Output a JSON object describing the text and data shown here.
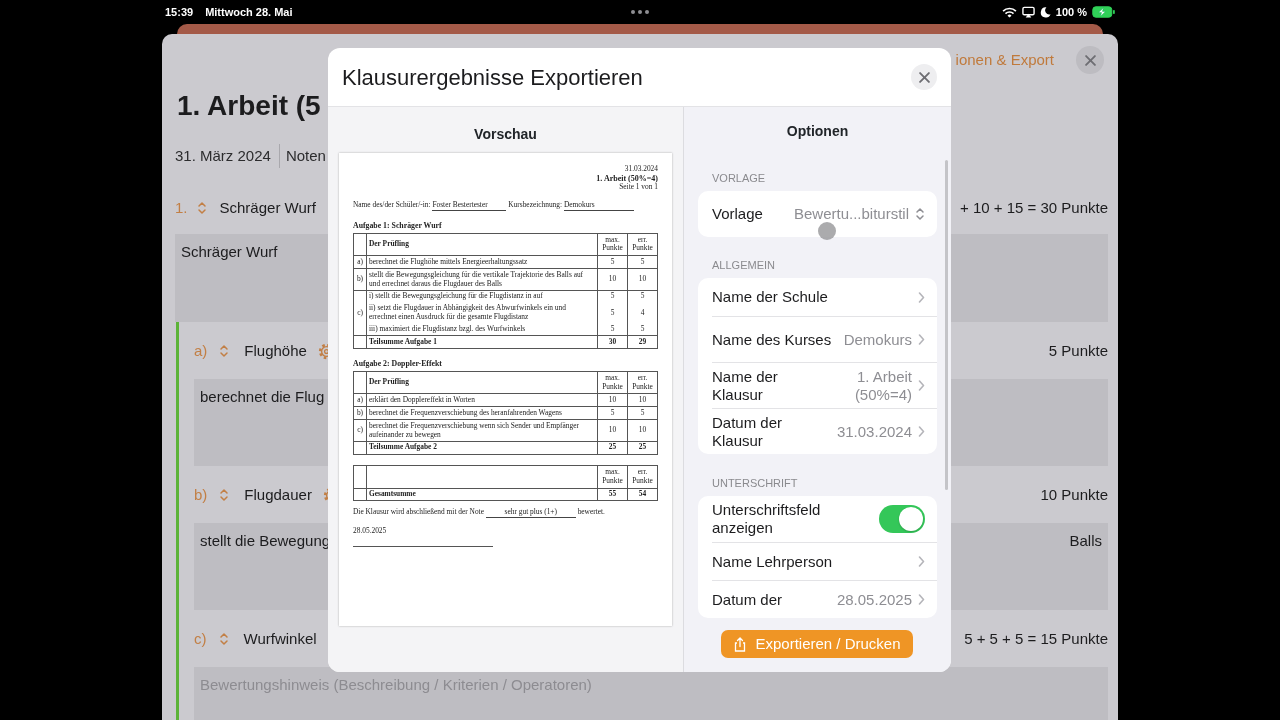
{
  "status_bar": {
    "time": "15:39",
    "date": "Mittwoch 28. Mai",
    "battery": "100 %"
  },
  "background": {
    "header_link": "ionen & Export",
    "title": "1. Arbeit (5",
    "date": "31. März 2024",
    "tab": "Noten",
    "items": [
      {
        "kind": "task",
        "number": "1.",
        "title": "Schräger Wurf",
        "gear": false,
        "points": "+ 10 + 15 = 30 Punkte",
        "text": "Schräger Wurf"
      },
      {
        "kind": "subtask",
        "number": "a)",
        "title": "Flughöhe",
        "gear": true,
        "points": "5 Punkte",
        "text": "berechnet die Flug"
      },
      {
        "kind": "subtask",
        "number": "b)",
        "title": "Flugdauer",
        "gear": true,
        "points": "10 Punkte",
        "text": "stellt die Bewegung",
        "text_end": "Balls"
      },
      {
        "kind": "subtask",
        "number": "c)",
        "title": "Wurfwinkel",
        "gear": false,
        "points": "5 + 5 + 5 = 15 Punkte",
        "placeholder": "Bewertungshinweis (Beschreibung / Kriterien / Operatoren)"
      }
    ]
  },
  "dialog": {
    "title": "Klausurergebnisse Exportieren",
    "preview": {
      "heading": "Vorschau",
      "document": {
        "date": "31.03.2024",
        "title": "1. Arbeit (50%=4)",
        "page": "Seite 1 von 1",
        "student_label": "Name des/der Schüler/-in:",
        "student": "Foster Bestertester",
        "course_label": "Kursbezeichnung:",
        "course": "Demokurs",
        "tasks": [
          {
            "heading": "Aufgabe 1: Schräger Wurf",
            "columns": [
              "Der Prüfling",
              "max. Punkte",
              "err. Punkte"
            ],
            "rows": [
              {
                "label": "a)",
                "lines": [
                  {
                    "text": "berechnet die Flughöhe mittels Energieerhaltungssatz",
                    "max": "5",
                    "got": "5"
                  }
                ]
              },
              {
                "label": "b)",
                "lines": [
                  {
                    "text": "stellt die Bewegungsgleichung für die vertikale Trajektorie des Balls auf und errechnet daraus die Flugdauer des Balls",
                    "max": "10",
                    "got": "10"
                  }
                ]
              },
              {
                "label": "c)",
                "lines": [
                  {
                    "text": "i) stellt die Bewegungsgleichung für die Flugdistanz in auf",
                    "max": "5",
                    "got": "5"
                  },
                  {
                    "text": "ii) setzt die Flugdauer in Abhängigkeit des Abwurfwinkels ein und errechnet einen Ausdruck für die gesamte Flugdistanz",
                    "max": "5",
                    "got": "4"
                  },
                  {
                    "text": "iii) maximiert die Flugdistanz bzgl. des Wurfwinkels",
                    "max": "5",
                    "got": "5"
                  }
                ]
              }
            ],
            "subtotal": {
              "label": "Teilsumme Aufgabe 1",
              "max": "30",
              "got": "29"
            }
          },
          {
            "heading": "Aufgabe 2: Doppler-Effekt",
            "columns": [
              "Der Prüfling",
              "max. Punkte",
              "err. Punkte"
            ],
            "rows": [
              {
                "label": "a)",
                "lines": [
                  {
                    "text": "erklärt den Dopplereffekt in Worten",
                    "max": "10",
                    "got": "10"
                  }
                ]
              },
              {
                "label": "b)",
                "lines": [
                  {
                    "text": "berechnet die Frequenzverschiebung des heranfahrenden Wagens",
                    "max": "5",
                    "got": "5"
                  }
                ]
              },
              {
                "label": "c)",
                "lines": [
                  {
                    "text": "berechnet die Frequenzverschiebung wenn sich Sender und Empfänger aufeinander zu bewegen",
                    "max": "10",
                    "got": "10"
                  }
                ]
              }
            ],
            "subtotal": {
              "label": "Teilsumme Aufgabe 2",
              "max": "25",
              "got": "25"
            }
          }
        ],
        "total": {
          "columns": [
            "max. Punkte",
            "err. Punkte"
          ],
          "label": "Gesamtsumme",
          "max": "55",
          "got": "54"
        },
        "grade_before": "Die Klausur wird abschließend mit der Note",
        "grade": "sehr gut plus (1+)",
        "grade_after": "bewertet.",
        "sign_date": "28.05.2025"
      }
    },
    "options": {
      "heading": "Optionen",
      "sections": [
        {
          "caption": "VORLAGE",
          "rows": [
            {
              "kind": "picker",
              "label": "Vorlage",
              "value": "Bewertu...biturstil"
            }
          ]
        },
        {
          "caption": "ALLGEMEIN",
          "rows": [
            {
              "kind": "link",
              "label": "Name der Schule"
            },
            {
              "kind": "link",
              "label": "Name des Kurses",
              "value": "Demokurs"
            },
            {
              "kind": "link",
              "label": "Name der Klausur",
              "value": "1. Arbeit (50%=4)"
            },
            {
              "kind": "link",
              "label": "Datum der Klausur",
              "value": "31.03.2024"
            }
          ]
        },
        {
          "caption": "UNTERSCHRIFT",
          "rows": [
            {
              "kind": "toggle",
              "label": "Unterschriftsfeld anzeigen",
              "on": true
            },
            {
              "kind": "link",
              "label": "Name Lehrperson"
            },
            {
              "kind": "link",
              "label": "Datum der",
              "value": "28.05.2025"
            }
          ]
        }
      ]
    },
    "export_button": "Exportieren / Drucken"
  }
}
